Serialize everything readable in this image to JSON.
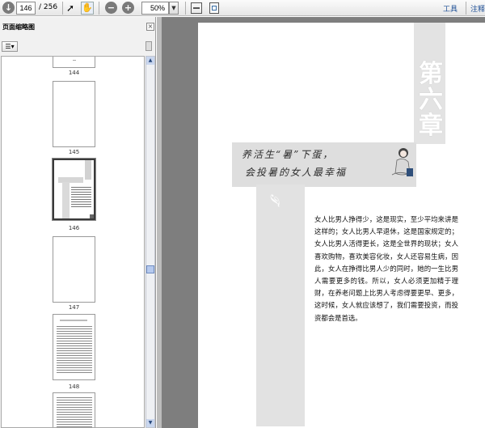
{
  "toolbar": {
    "page_current": "146",
    "page_total": "/ 256",
    "zoom": "50%",
    "tools_label": "工具",
    "comment_label": "注释"
  },
  "panel": {
    "title": "页面缩略图",
    "thumbnails": [
      {
        "label": "144"
      },
      {
        "label": "145"
      },
      {
        "label": "146",
        "selected": true
      },
      {
        "label": "147"
      },
      {
        "label": "148"
      }
    ]
  },
  "page": {
    "chapter_title": "第六章",
    "header_line1": "养活生“暑”下蛋，",
    "header_line2": "会投暑的女人最幸福",
    "body_text": "女人比男人挣得少，这是现实，至少平均来讲是这样的；女人比男人早退休，这是国家规定的；女人比男人活得更长，这是全世界的现状；女人喜欢购物，喜欢美容化妆，女人还容易生病，因此，女人在挣得比男人少的同时，她的一生比男人需要更多的钱。所以，女人必须更加精于理财，在养老问题上比男人考虑得要更早、更多，这时候，女人就应该想了，我们需要投资，而投资都会是首选。"
  },
  "colors": {
    "doc_bg": "#7e7e7e",
    "accent_link": "#1e4f96"
  }
}
